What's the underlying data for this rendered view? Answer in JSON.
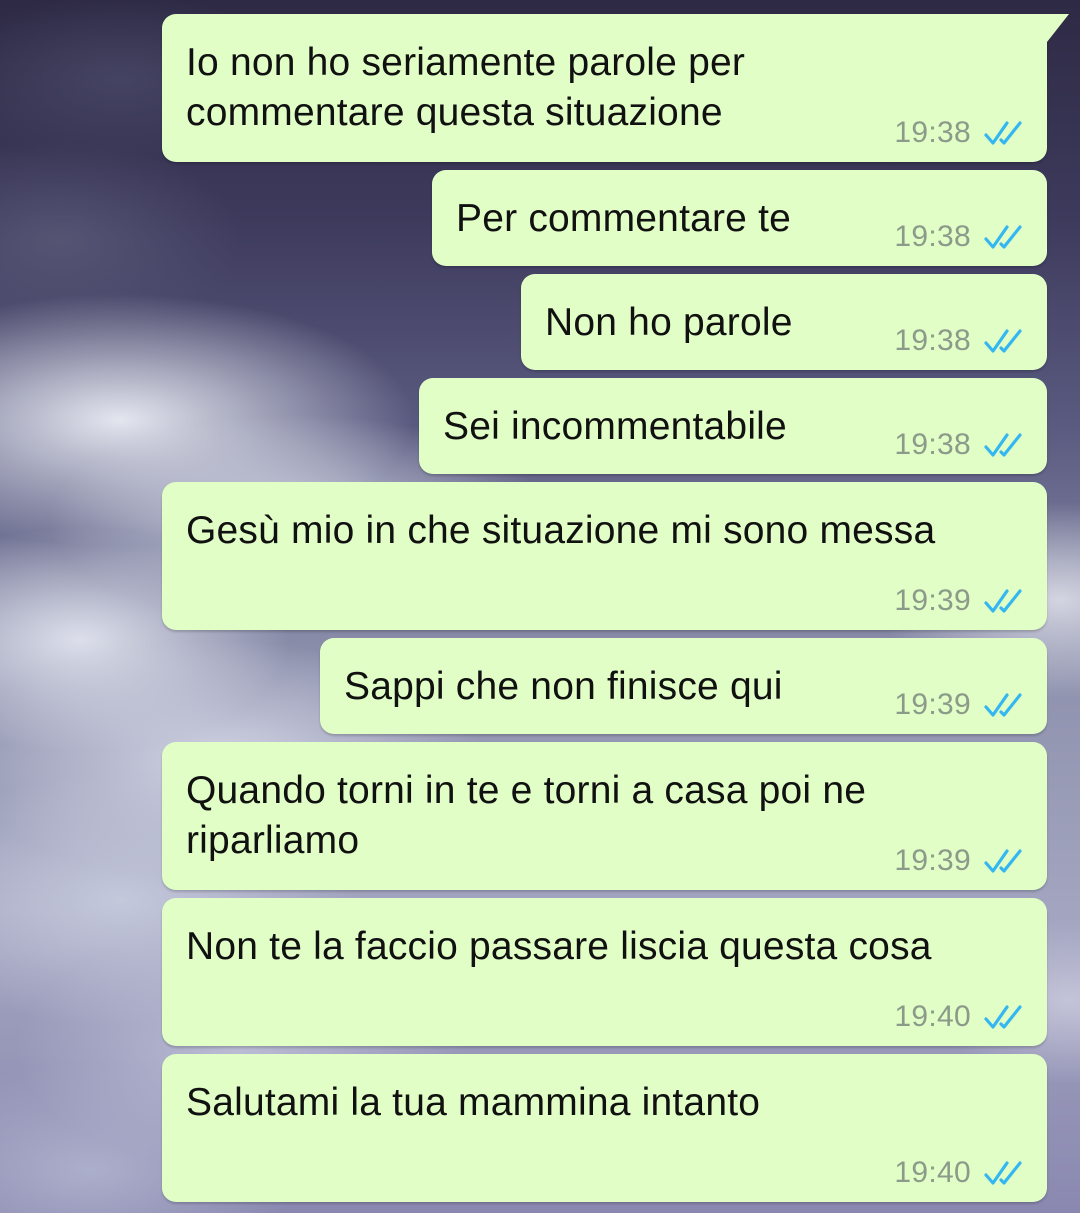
{
  "conversation": {
    "messages": [
      {
        "text": "Io non ho seriamente parole per\ncommentare questa situazione",
        "time": "19:38",
        "status": "read"
      },
      {
        "text": "Per commentare te",
        "time": "19:38",
        "status": "read"
      },
      {
        "text": "Non ho parole",
        "time": "19:38",
        "status": "read"
      },
      {
        "text": "Sei incommentabile",
        "time": "19:38",
        "status": "read"
      },
      {
        "text": "Gesù mio in che situazione mi sono messa",
        "time": "19:39",
        "status": "read"
      },
      {
        "text": "Sappi che non finisce qui",
        "time": "19:39",
        "status": "read"
      },
      {
        "text": "Quando torni in te e torni a casa poi ne\nriparliamo",
        "time": "19:39",
        "status": "read"
      },
      {
        "text": "Non te la faccio passare liscia questa cosa",
        "time": "19:40",
        "status": "read"
      },
      {
        "text": "Salutami la tua mammina intanto",
        "time": "19:40",
        "status": "read"
      }
    ]
  },
  "colors": {
    "bubble_outgoing": "#e1fec6",
    "timestamp": "#8c9a8a",
    "read_ticks": "#34b7f1"
  },
  "icons": {
    "read_receipt": "double-check-icon"
  }
}
